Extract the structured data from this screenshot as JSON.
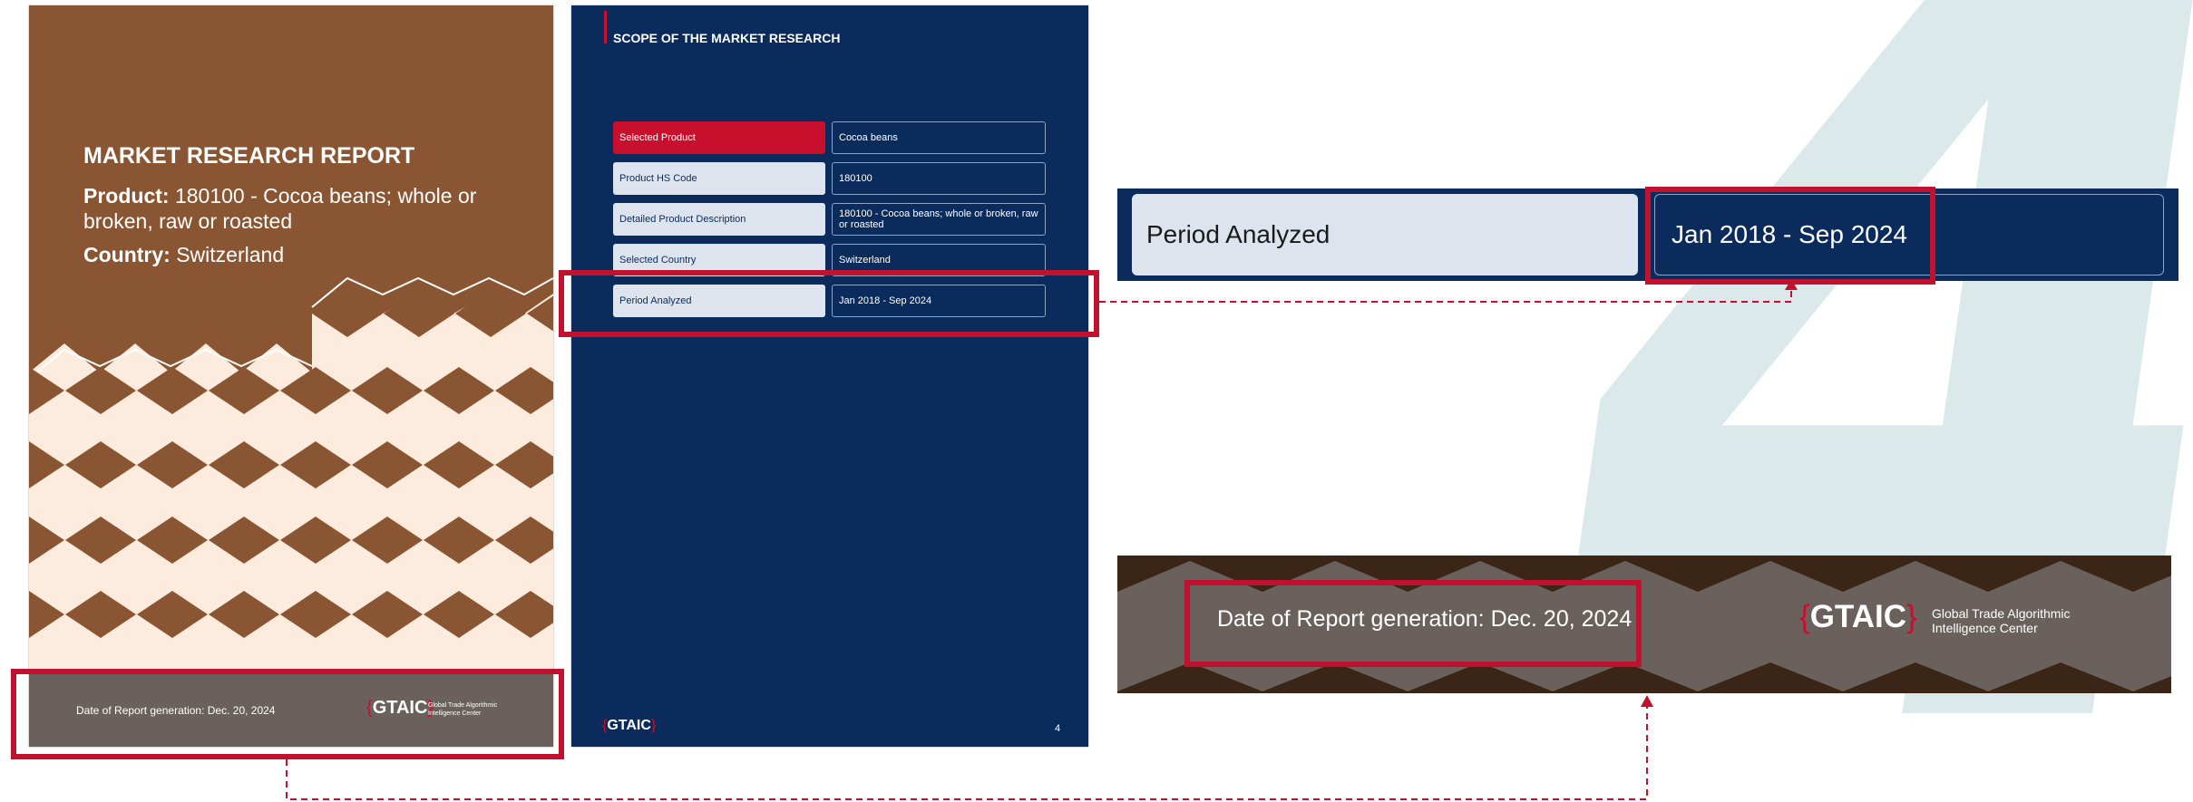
{
  "watermark": {
    "page_number": "4"
  },
  "cover": {
    "title": "MARKET RESEARCH REPORT",
    "product_label": "Product:",
    "product_value": " 180100 - Cocoa beans; whole or broken, raw or roasted",
    "country_label": "Country:",
    "country_value": " Switzerland",
    "footer_date": "Date of Report generation: Dec. 20, 2024",
    "logo_open": "{",
    "logo_text": "GTAIC",
    "logo_close": "}",
    "logo_sub_line1": "Global Trade Algorithmic",
    "logo_sub_line2": "Intelligence Center",
    "colors": {
      "background": "#8a5532",
      "pattern_light": "#fdebdd",
      "footer": "#6a615c"
    }
  },
  "scope": {
    "title": "SCOPE OF THE MARKET RESEARCH",
    "rows": [
      {
        "label": "Selected Product",
        "value": "Cocoa beans",
        "selected": true
      },
      {
        "label": "Product HS Code",
        "value": "180100",
        "selected": false
      },
      {
        "label": "Detailed Product Description",
        "value": "180100 - Cocoa beans; whole or broken, raw or roasted",
        "selected": false
      },
      {
        "label": "Selected Country",
        "value": "Switzerland",
        "selected": false
      },
      {
        "label": "Period Analyzed",
        "value": "Jan 2018 - Sep 2024",
        "selected": false
      }
    ],
    "logo_open": "{",
    "logo_text": "GTAIC",
    "logo_close": "}",
    "page_number": "4",
    "colors": {
      "background": "#0b2b5c",
      "accent": "#c8102e"
    }
  },
  "period_zoom": {
    "label": "Period Analyzed",
    "value": "Jan 2018 - Sep 2024"
  },
  "footer_zoom": {
    "date": "Date of Report generation: Dec. 20, 2024",
    "logo_open": "{",
    "logo_text": "GTAIC",
    "logo_close": "}",
    "sub_line1": "Global Trade Algorithmic",
    "sub_line2": "Intelligence Center"
  },
  "highlight_color": "#c0122f"
}
